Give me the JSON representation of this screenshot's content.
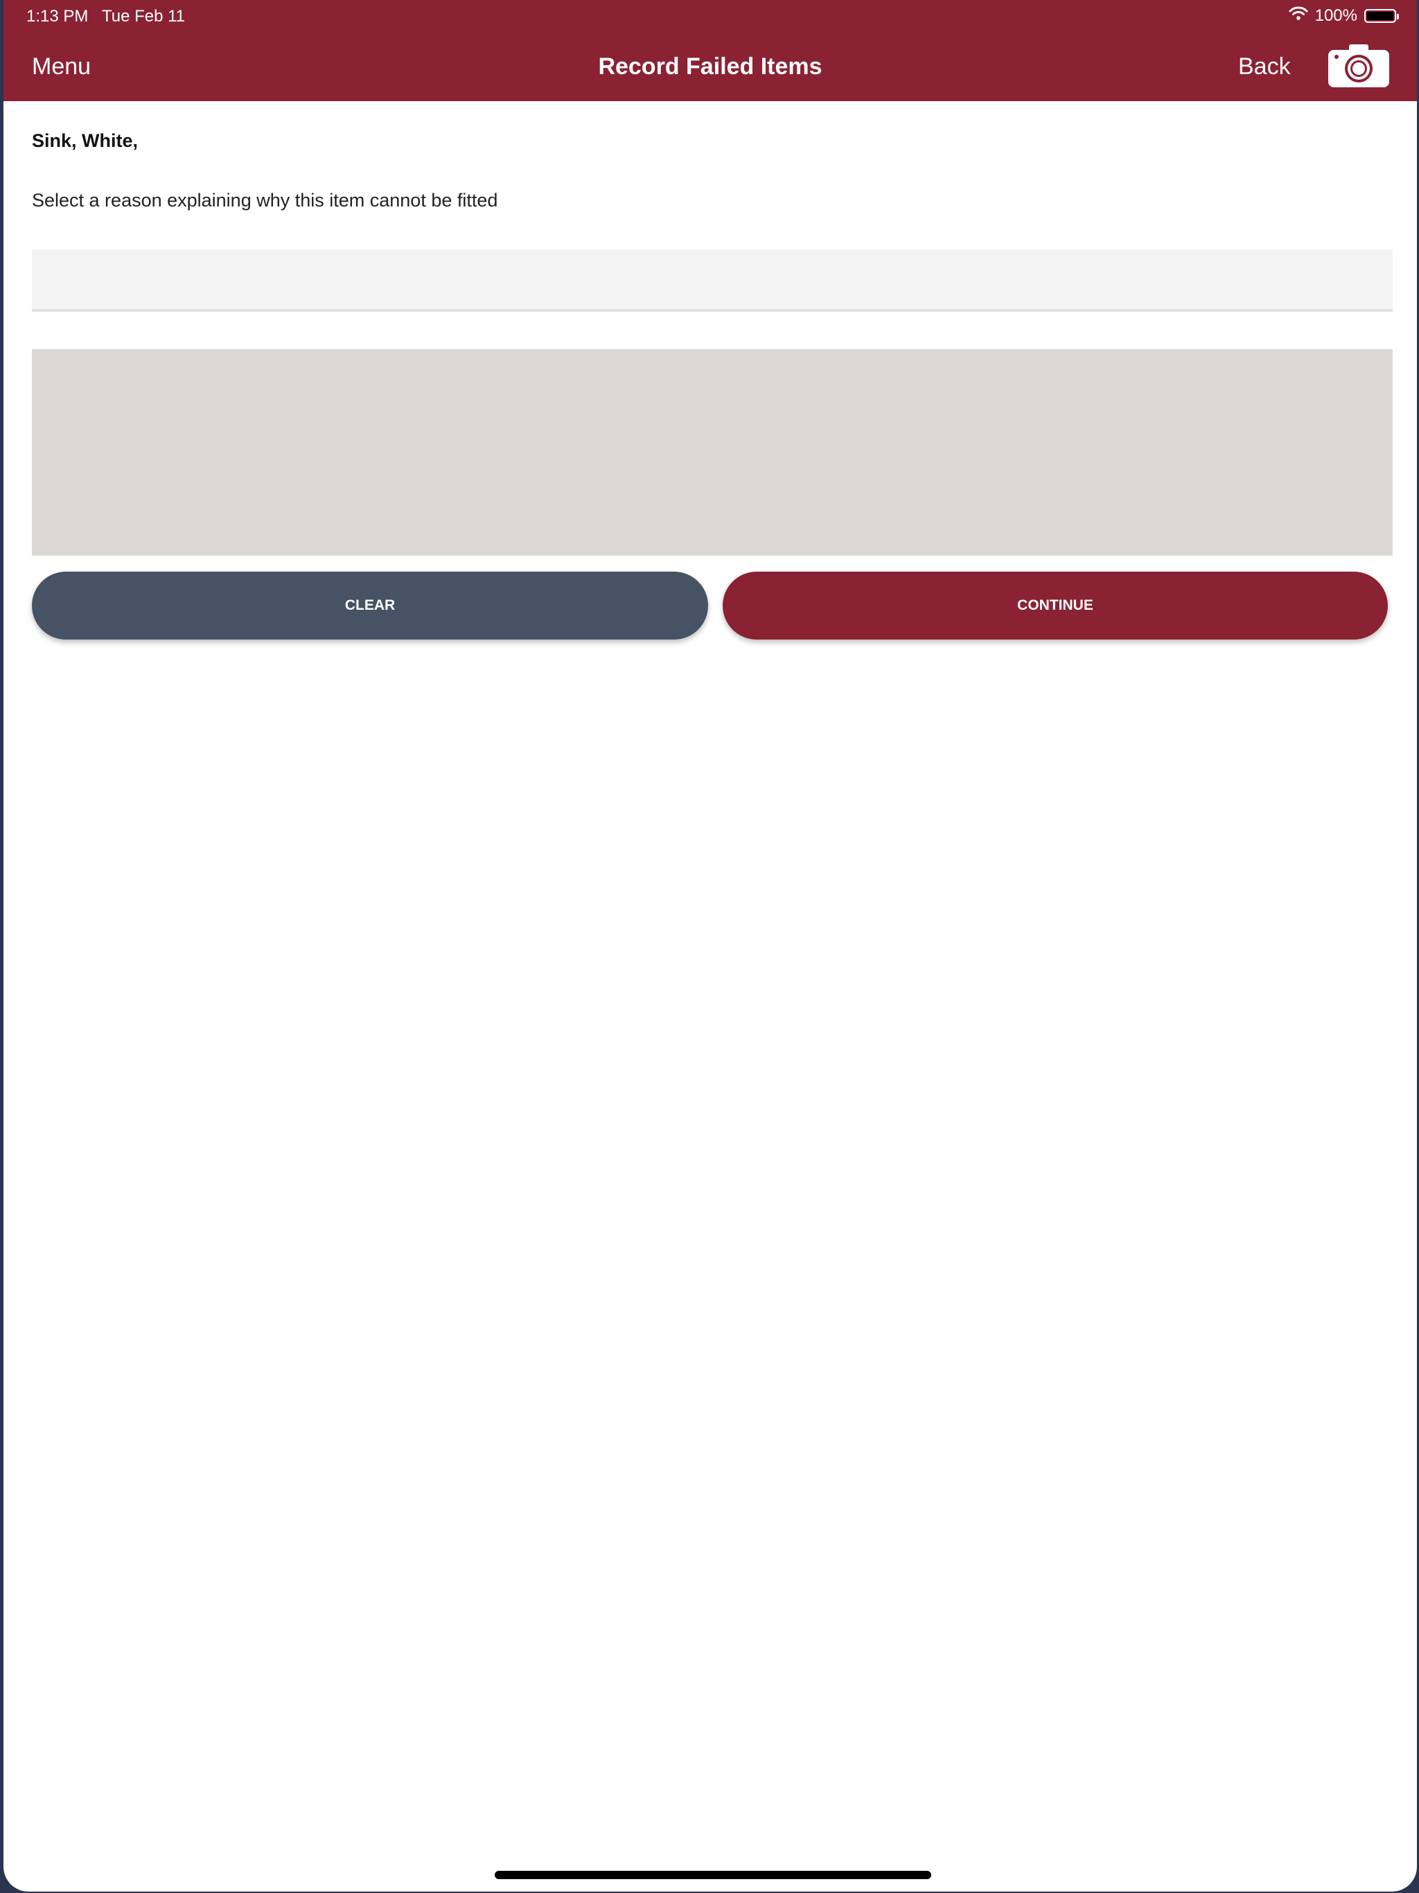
{
  "status_bar": {
    "time": "1:13 PM   Tue Feb 11",
    "battery_text": "100%",
    "battery_level": 1.0,
    "wifi_icon": "wifi-icon",
    "battery_icon": "battery-icon"
  },
  "nav": {
    "menu_label": "Menu",
    "title": "Record Failed Items",
    "back_label": "Back",
    "camera_icon": "camera-icon"
  },
  "content": {
    "item_title": "Sink, White,",
    "instruction": "Select a reason explaining why this item cannot be fitted",
    "reason_value": "",
    "notes_value": ""
  },
  "buttons": {
    "clear_label": "CLEAR",
    "continue_label": "CONTINUE"
  },
  "colors": {
    "brand": "#8a2234",
    "clear_button": "#465364",
    "notes_background": "#dbd7d7",
    "select_background": "#f3f3f3"
  }
}
